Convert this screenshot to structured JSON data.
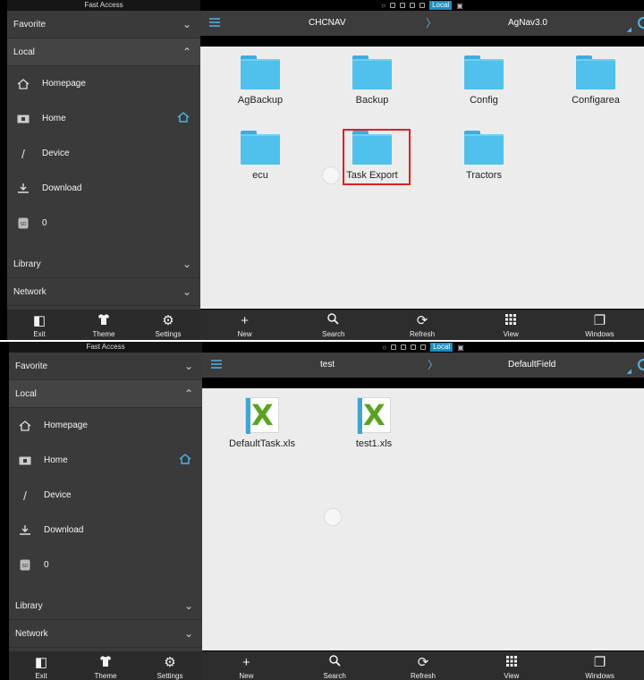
{
  "panels": [
    {
      "sidebar": {
        "title": "Fast Access",
        "favorite": "Favorite",
        "local": "Local",
        "items": [
          {
            "label": "Homepage",
            "icon": "homepage-icon"
          },
          {
            "label": "Home",
            "icon": "folder-home-icon"
          },
          {
            "label": "Device",
            "icon": "slash-device-icon"
          },
          {
            "label": "Download",
            "icon": "download-icon"
          },
          {
            "label": "0",
            "icon": "sd-card-icon"
          }
        ],
        "library": "Library",
        "network": "Network",
        "bottom": [
          "Exit",
          "Theme",
          "Settings"
        ]
      },
      "status": {
        "local_badge": "Local"
      },
      "path": {
        "first": "CHCNAV",
        "second": "AgNav3.0"
      },
      "folders": [
        "AgBackup",
        "Backup",
        "Config",
        "Configarea",
        "ecu",
        "Task Export",
        "Tractors"
      ],
      "toolbar": [
        "New",
        "Search",
        "Refresh",
        "View",
        "Windows"
      ]
    },
    {
      "sidebar": {
        "title": "Fast Access",
        "favorite": "Favorite",
        "local": "Local",
        "items": [
          {
            "label": "Homepage",
            "icon": "homepage-icon"
          },
          {
            "label": "Home",
            "icon": "folder-home-icon"
          },
          {
            "label": "Device",
            "icon": "slash-device-icon"
          },
          {
            "label": "Download",
            "icon": "download-icon"
          },
          {
            "label": "0",
            "icon": "sd-card-icon"
          }
        ],
        "library": "Library",
        "network": "Network",
        "bottom": [
          "Exit",
          "Theme",
          "Settings"
        ]
      },
      "status": {
        "local_badge": "Local"
      },
      "path": {
        "first": "test",
        "second": "DefaultField"
      },
      "files": [
        "DefaultTask.xls",
        "test1.xls"
      ],
      "toolbar": [
        "New",
        "Search",
        "Refresh",
        "View",
        "Windows"
      ]
    }
  ],
  "colors": {
    "accent": "#4fb3e8",
    "folder": "#4fc1ec",
    "highlight": "#e02020",
    "excel_green": "#5aa31e"
  }
}
